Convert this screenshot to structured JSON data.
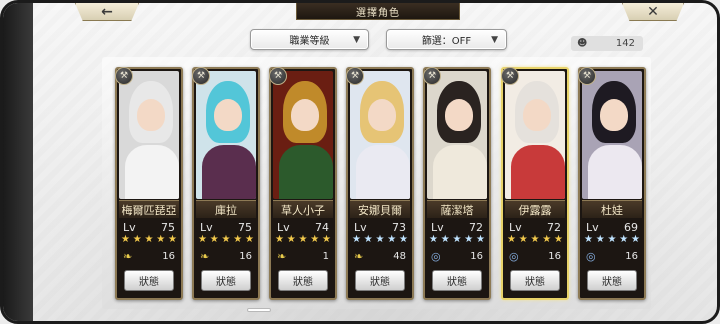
{
  "header": {
    "title": "選擇角色",
    "back_icon": "back-arrow-icon",
    "close_icon": "close-x-icon"
  },
  "filters": {
    "job_level": "職業等級",
    "filter": "篩選：OFF"
  },
  "counter": {
    "icon": "person-icon",
    "value": "142"
  },
  "cards": [
    {
      "name": "梅爾匹琵亞",
      "lv": "75",
      "stars": 5,
      "star_color": "gold",
      "stat_icon": "wing-icon",
      "stat": "16",
      "button": "狀態",
      "selected": false,
      "colors": {
        "bg": "#d9d9d9",
        "hair": "#e8e8e8",
        "body": "#f3f3f3"
      }
    },
    {
      "name": "庫拉",
      "lv": "75",
      "stars": 5,
      "star_color": "gold",
      "stat_icon": "wing-icon",
      "stat": "16",
      "button": "狀態",
      "selected": false,
      "colors": {
        "bg": "#cfe3ea",
        "hair": "#53c6d8",
        "body": "#5a2e4e"
      }
    },
    {
      "name": "草人小子",
      "lv": "74",
      "stars": 5,
      "star_color": "gold",
      "stat_icon": "wing-icon",
      "stat": "1",
      "button": "狀態",
      "selected": false,
      "colors": {
        "bg": "#6a1e12",
        "hair": "#c08a2a",
        "body": "#2c5a2c"
      }
    },
    {
      "name": "安娜貝爾",
      "lv": "73",
      "stars": 5,
      "star_color": "blue",
      "stat_icon": "wing-icon",
      "stat": "48",
      "button": "狀態",
      "selected": false,
      "colors": {
        "bg": "#dfe6ef",
        "hair": "#e6c475",
        "body": "#eaeaf2"
      }
    },
    {
      "name": "薩潔塔",
      "lv": "72",
      "stars": 5,
      "star_color": "blue",
      "stat_icon": "swirl-icon",
      "stat": "16",
      "button": "狀態",
      "selected": false,
      "colors": {
        "bg": "#dcd7cc",
        "hair": "#2a2320",
        "body": "#efe9dc"
      }
    },
    {
      "name": "伊露露",
      "lv": "72",
      "stars": 5,
      "star_color": "gold",
      "stat_icon": "swirl-icon",
      "stat": "16",
      "button": "狀態",
      "selected": true,
      "colors": {
        "bg": "#f2ece4",
        "hair": "#e5e1dc",
        "body": "#c83a3a"
      }
    },
    {
      "name": "杜娃",
      "lv": "69",
      "stars": 5,
      "star_color": "blue",
      "stat_icon": "swirl-icon",
      "stat": "16",
      "button": "狀態",
      "selected": false,
      "colors": {
        "bg": "#a9a3b5",
        "hair": "#1e1a22",
        "body": "#ece8f0"
      }
    }
  ],
  "labels": {
    "lv": "Lv"
  }
}
